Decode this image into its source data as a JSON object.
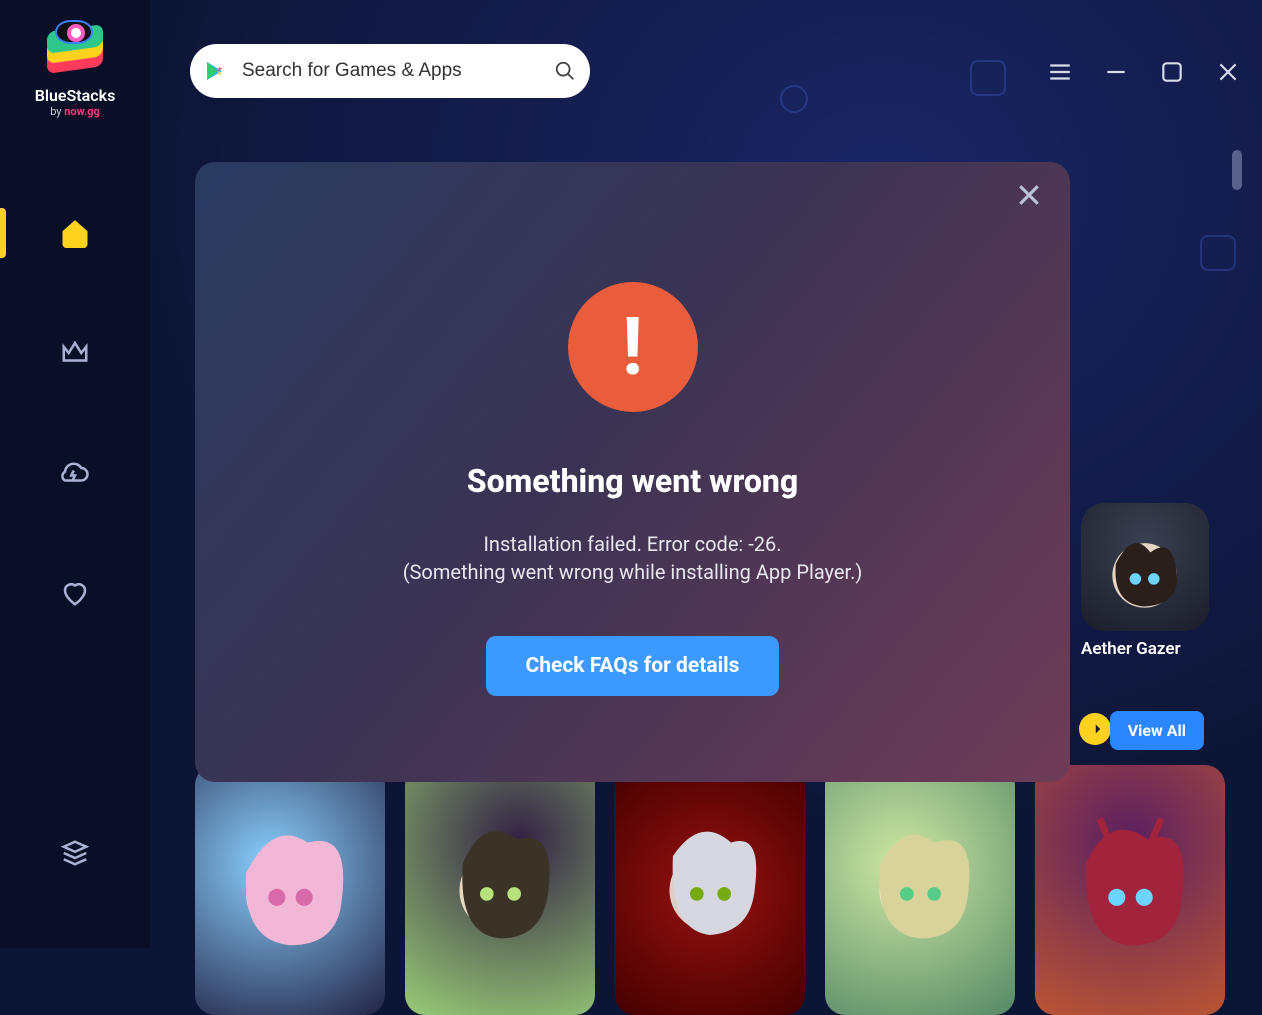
{
  "brand": {
    "name": "BlueStacks",
    "sub_prefix": "by ",
    "sub_brand": "now.gg"
  },
  "search": {
    "placeholder": "Search for Games & Apps"
  },
  "modal": {
    "title": "Something went wrong",
    "message_line1": "Installation failed. Error code: -26.",
    "message_line2": "(Something went wrong while installing App Player.)",
    "cta": "Check FAQs for details"
  },
  "content": {
    "featured_game_label": "Aether Gazer",
    "view_all_label": "View All"
  },
  "colors": {
    "accent_yellow": "#ffd21f",
    "accent_blue": "#2b87ff",
    "alert_red": "#e95c3c"
  }
}
